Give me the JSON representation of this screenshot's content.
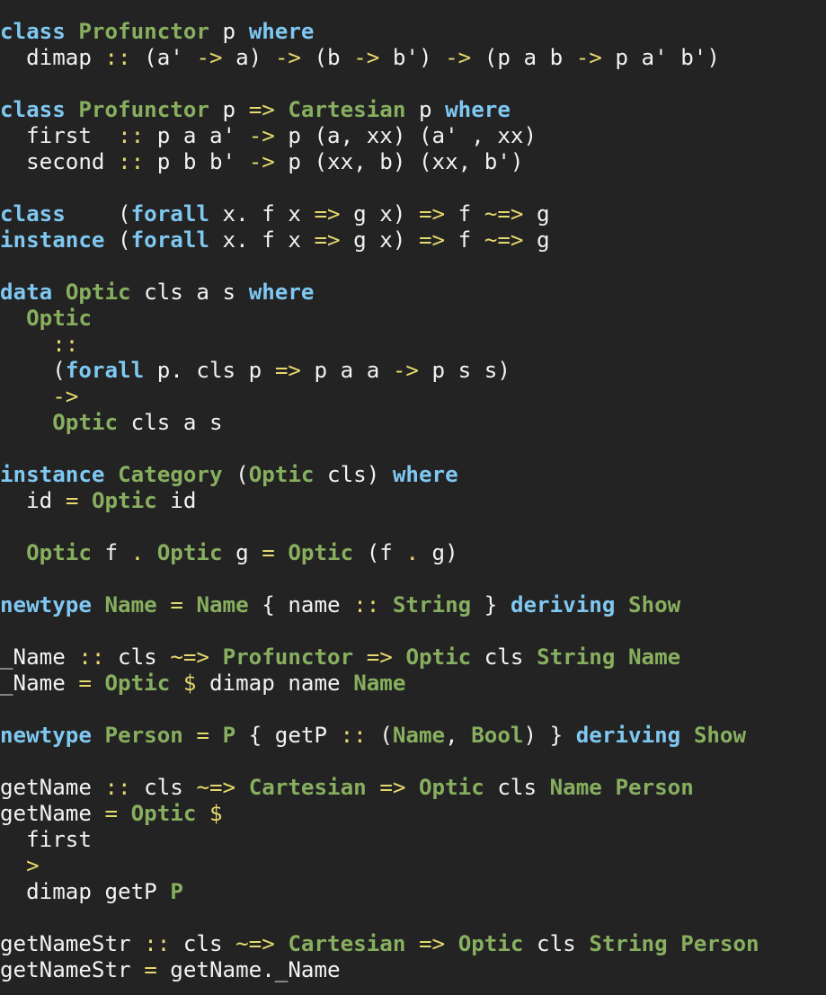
{
  "editor": {
    "theme": {
      "background": "#232323",
      "keyword": "#7fc8f2",
      "type_constructor": "#87af5f",
      "operator": "#e6d96d",
      "identifier": "#f2f2f2"
    },
    "lines": [
      [
        [
          "kw",
          "class"
        ],
        [
          "id",
          " "
        ],
        [
          "ty",
          "Profunctor"
        ],
        [
          "id",
          " p "
        ],
        [
          "kw",
          "where"
        ]
      ],
      [
        [
          "id",
          "  dimap "
        ],
        [
          "op",
          "::"
        ],
        [
          "id",
          " (a' "
        ],
        [
          "op",
          "->"
        ],
        [
          "id",
          " a) "
        ],
        [
          "op",
          "->"
        ],
        [
          "id",
          " (b "
        ],
        [
          "op",
          "->"
        ],
        [
          "id",
          " b') "
        ],
        [
          "op",
          "->"
        ],
        [
          "id",
          " (p a b "
        ],
        [
          "op",
          "->"
        ],
        [
          "id",
          " p a' b')"
        ]
      ],
      [],
      [
        [
          "kw",
          "class"
        ],
        [
          "id",
          " "
        ],
        [
          "ty",
          "Profunctor"
        ],
        [
          "id",
          " p "
        ],
        [
          "op",
          "=>"
        ],
        [
          "id",
          " "
        ],
        [
          "ty",
          "Cartesian"
        ],
        [
          "id",
          " p "
        ],
        [
          "kw",
          "where"
        ]
      ],
      [
        [
          "id",
          "  first  "
        ],
        [
          "op",
          "::"
        ],
        [
          "id",
          " p a a' "
        ],
        [
          "op",
          "->"
        ],
        [
          "id",
          " p (a, xx) (a' , xx)"
        ]
      ],
      [
        [
          "id",
          "  second "
        ],
        [
          "op",
          "::"
        ],
        [
          "id",
          " p b b' "
        ],
        [
          "op",
          "->"
        ],
        [
          "id",
          " p (xx, b) (xx, b')"
        ]
      ],
      [],
      [
        [
          "kw",
          "class"
        ],
        [
          "id",
          "    ("
        ],
        [
          "kw",
          "forall"
        ],
        [
          "id",
          " x. f x "
        ],
        [
          "op",
          "=>"
        ],
        [
          "id",
          " g x) "
        ],
        [
          "op",
          "=>"
        ],
        [
          "id",
          " f "
        ],
        [
          "op",
          "~=>"
        ],
        [
          "id",
          " g"
        ]
      ],
      [
        [
          "kw",
          "instance"
        ],
        [
          "id",
          " ("
        ],
        [
          "kw",
          "forall"
        ],
        [
          "id",
          " x. f x "
        ],
        [
          "op",
          "=>"
        ],
        [
          "id",
          " g x) "
        ],
        [
          "op",
          "=>"
        ],
        [
          "id",
          " f "
        ],
        [
          "op",
          "~=>"
        ],
        [
          "id",
          " g"
        ]
      ],
      [],
      [
        [
          "kw",
          "data"
        ],
        [
          "id",
          " "
        ],
        [
          "ty",
          "Optic"
        ],
        [
          "id",
          " cls a s "
        ],
        [
          "kw",
          "where"
        ]
      ],
      [
        [
          "id",
          "  "
        ],
        [
          "ty",
          "Optic"
        ]
      ],
      [
        [
          "id",
          "    "
        ],
        [
          "op",
          "::"
        ]
      ],
      [
        [
          "id",
          "    ("
        ],
        [
          "kw",
          "forall"
        ],
        [
          "id",
          " p. cls p "
        ],
        [
          "op",
          "=>"
        ],
        [
          "id",
          " p a a "
        ],
        [
          "op",
          "->"
        ],
        [
          "id",
          " p s s)"
        ]
      ],
      [
        [
          "id",
          "    "
        ],
        [
          "op",
          "->"
        ]
      ],
      [
        [
          "id",
          "    "
        ],
        [
          "ty",
          "Optic"
        ],
        [
          "id",
          " cls a s"
        ]
      ],
      [],
      [
        [
          "kw",
          "instance"
        ],
        [
          "id",
          " "
        ],
        [
          "ty",
          "Category"
        ],
        [
          "id",
          " ("
        ],
        [
          "ty",
          "Optic"
        ],
        [
          "id",
          " cls) "
        ],
        [
          "kw",
          "where"
        ]
      ],
      [
        [
          "id",
          "  id "
        ],
        [
          "op",
          "="
        ],
        [
          "id",
          " "
        ],
        [
          "ty",
          "Optic"
        ],
        [
          "id",
          " id"
        ]
      ],
      [],
      [
        [
          "id",
          "  "
        ],
        [
          "ty",
          "Optic"
        ],
        [
          "id",
          " f "
        ],
        [
          "op",
          "."
        ],
        [
          "id",
          " "
        ],
        [
          "ty",
          "Optic"
        ],
        [
          "id",
          " g "
        ],
        [
          "op",
          "="
        ],
        [
          "id",
          " "
        ],
        [
          "ty",
          "Optic"
        ],
        [
          "id",
          " (f "
        ],
        [
          "op",
          "."
        ],
        [
          "id",
          " g)"
        ]
      ],
      [],
      [
        [
          "kw",
          "newtype"
        ],
        [
          "id",
          " "
        ],
        [
          "ty",
          "Name"
        ],
        [
          "id",
          " "
        ],
        [
          "op",
          "="
        ],
        [
          "id",
          " "
        ],
        [
          "ty",
          "Name"
        ],
        [
          "id",
          " { name "
        ],
        [
          "op",
          "::"
        ],
        [
          "id",
          " "
        ],
        [
          "ty",
          "String"
        ],
        [
          "id",
          " } "
        ],
        [
          "kw",
          "deriving"
        ],
        [
          "id",
          " "
        ],
        [
          "ty",
          "Show"
        ]
      ],
      [],
      [
        [
          "id",
          "_Name "
        ],
        [
          "op",
          "::"
        ],
        [
          "id",
          " cls "
        ],
        [
          "op",
          "~=>"
        ],
        [
          "id",
          " "
        ],
        [
          "ty",
          "Profunctor"
        ],
        [
          "id",
          " "
        ],
        [
          "op",
          "=>"
        ],
        [
          "id",
          " "
        ],
        [
          "ty",
          "Optic"
        ],
        [
          "id",
          " cls "
        ],
        [
          "ty",
          "String"
        ],
        [
          "id",
          " "
        ],
        [
          "ty",
          "Name"
        ]
      ],
      [
        [
          "id",
          "_Name "
        ],
        [
          "op",
          "="
        ],
        [
          "id",
          " "
        ],
        [
          "ty",
          "Optic"
        ],
        [
          "id",
          " "
        ],
        [
          "op",
          "$"
        ],
        [
          "id",
          " dimap name "
        ],
        [
          "ty",
          "Name"
        ]
      ],
      [],
      [
        [
          "kw",
          "newtype"
        ],
        [
          "id",
          " "
        ],
        [
          "ty",
          "Person"
        ],
        [
          "id",
          " "
        ],
        [
          "op",
          "="
        ],
        [
          "id",
          " "
        ],
        [
          "ty",
          "P"
        ],
        [
          "id",
          " { getP "
        ],
        [
          "op",
          "::"
        ],
        [
          "id",
          " ("
        ],
        [
          "ty",
          "Name"
        ],
        [
          "id",
          ", "
        ],
        [
          "ty",
          "Bool"
        ],
        [
          "id",
          ") } "
        ],
        [
          "kw",
          "deriving"
        ],
        [
          "id",
          " "
        ],
        [
          "ty",
          "Show"
        ]
      ],
      [],
      [
        [
          "id",
          "getName "
        ],
        [
          "op",
          "::"
        ],
        [
          "id",
          " cls "
        ],
        [
          "op",
          "~=>"
        ],
        [
          "id",
          " "
        ],
        [
          "ty",
          "Cartesian"
        ],
        [
          "id",
          " "
        ],
        [
          "op",
          "=>"
        ],
        [
          "id",
          " "
        ],
        [
          "ty",
          "Optic"
        ],
        [
          "id",
          " cls "
        ],
        [
          "ty",
          "Name"
        ],
        [
          "id",
          " "
        ],
        [
          "ty",
          "Person"
        ]
      ],
      [
        [
          "id",
          "getName "
        ],
        [
          "op",
          "="
        ],
        [
          "id",
          " "
        ],
        [
          "ty",
          "Optic"
        ],
        [
          "id",
          " "
        ],
        [
          "op",
          "$"
        ]
      ],
      [
        [
          "id",
          "  first"
        ]
      ],
      [
        [
          "id",
          "  "
        ],
        [
          "op",
          ">"
        ]
      ],
      [
        [
          "id",
          "  dimap getP "
        ],
        [
          "ty",
          "P"
        ]
      ],
      [],
      [
        [
          "id",
          "getNameStr "
        ],
        [
          "op",
          "::"
        ],
        [
          "id",
          " cls "
        ],
        [
          "op",
          "~=>"
        ],
        [
          "id",
          " "
        ],
        [
          "ty",
          "Cartesian"
        ],
        [
          "id",
          " "
        ],
        [
          "op",
          "=>"
        ],
        [
          "id",
          " "
        ],
        [
          "ty",
          "Optic"
        ],
        [
          "id",
          " cls "
        ],
        [
          "ty",
          "String"
        ],
        [
          "id",
          " "
        ],
        [
          "ty",
          "Person"
        ]
      ],
      [
        [
          "id",
          "getNameStr "
        ],
        [
          "op",
          "="
        ],
        [
          "id",
          " getName._Name"
        ]
      ]
    ]
  }
}
